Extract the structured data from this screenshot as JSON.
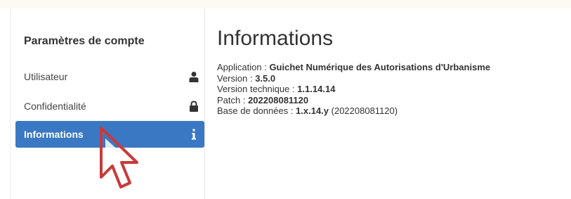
{
  "sidebar": {
    "title": "Paramètres de compte",
    "items": [
      {
        "label": "Utilisateur",
        "icon": "user-icon"
      },
      {
        "label": "Confidentialité",
        "icon": "lock-icon"
      },
      {
        "label": "Informations",
        "icon": "info-icon",
        "active": true
      }
    ]
  },
  "main": {
    "title": "Informations",
    "application_label": "Application : ",
    "application_value": "Guichet Numérique des Autorisations d'Urbanisme",
    "version_label": "Version : ",
    "version_value": "3.5.0",
    "tech_version_label": "Version technique : ",
    "tech_version_value": "1.1.14.14",
    "patch_label": "Patch : ",
    "patch_value": "202208081120",
    "db_label": "Base de données : ",
    "db_value": "1.x.14.y",
    "db_extra": " (202208081120)"
  },
  "colors": {
    "active_bg": "#3a78c4",
    "cursor": "#c83a3a"
  }
}
